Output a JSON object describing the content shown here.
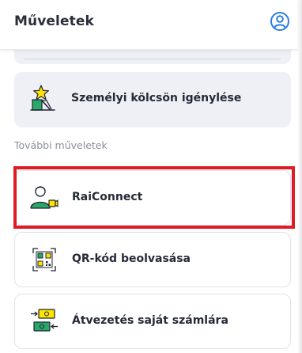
{
  "header": {
    "title": "Műveletek",
    "profile_icon": "user-circle-icon"
  },
  "primary_action": {
    "label": "Személyi kölcsön igénylése",
    "icon": "loan-star-icon"
  },
  "section": {
    "title": "További műveletek"
  },
  "actions": [
    {
      "label": "RaiConnect",
      "icon": "video-agent-icon",
      "highlighted": true
    },
    {
      "label": "QR-kód beolvasása",
      "icon": "qr-scan-icon"
    },
    {
      "label": "Átvezetés saját számlára",
      "icon": "money-transfer-icon"
    }
  ],
  "colors": {
    "accent": "#2a7de1",
    "highlight": "#e01b24",
    "shaded_card": "#eef0f6",
    "icon_yellow": "#ffe400",
    "icon_green": "#2aa86a"
  }
}
